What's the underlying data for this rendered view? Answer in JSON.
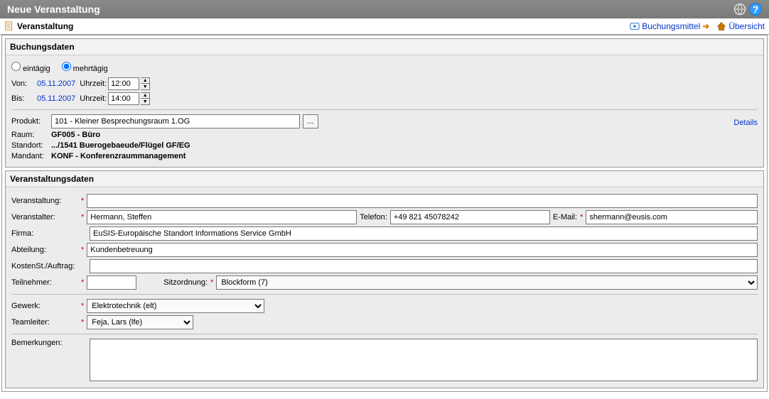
{
  "title": "Neue Veranstaltung",
  "top_links": {
    "buchungsmittel": "Buchungsmittel",
    "uebersicht": "Übersicht"
  },
  "tab_label": "Veranstaltung",
  "buchungsdaten": {
    "title": "Buchungsdaten",
    "eintaegig_label": "eintägig",
    "mehrtaegig_label": "mehrtägig",
    "duration_mode": "mehrtägig",
    "von_label": "Von:",
    "von_date": "05.11.2007",
    "bis_label": "Bis:",
    "bis_date": "05.11.2007",
    "uhrzeit_label": "Uhrzeit:",
    "von_time": "12:00",
    "bis_time": "14:00",
    "produkt_label": "Produkt:",
    "produkt_value": "101 - Kleiner Besprechungsraum 1.OG",
    "raum_label": "Raum:",
    "raum_value": "GF005 - Büro",
    "standort_label": "Standort:",
    "standort_value": ".../1541 Buerogebaeude/Flügel GF/EG",
    "mandant_label": "Mandant:",
    "mandant_value": "KONF - Konferenzraummanagement",
    "details_label": "Details"
  },
  "veranstaltungsdaten": {
    "title": "Veranstaltungsdaten",
    "veranstaltung_label": "Veranstaltung:",
    "veranstaltung_value": "",
    "veranstalter_label": "Veranstalter:",
    "veranstalter_value": "Hermann, Steffen",
    "telefon_label": "Telefon:",
    "telefon_value": "+49 821 45078242",
    "email_label": "E-Mail:",
    "email_value": "shermann@eusis.com",
    "firma_label": "Firma:",
    "firma_value": "EuSIS-Europäische Standort Informations Service GmbH",
    "abteilung_label": "Abteilung:",
    "abteilung_value": "Kundenbetreuung",
    "kostenst_label": "KostenSt./Auftrag:",
    "kostenst_value": "",
    "teilnehmer_label": "Teilnehmer:",
    "teilnehmer_value": "",
    "sitzordnung_label": "Sitzordnung:",
    "sitzordnung_value": "Blockform (7)",
    "gewerk_label": "Gewerk:",
    "gewerk_value": "Elektrotechnik (elt)",
    "teamleiter_label": "Teamleiter:",
    "teamleiter_value": "Feja, Lars (lfe)",
    "bemerkungen_label": "Bemerkungen:",
    "bemerkungen_value": ""
  }
}
